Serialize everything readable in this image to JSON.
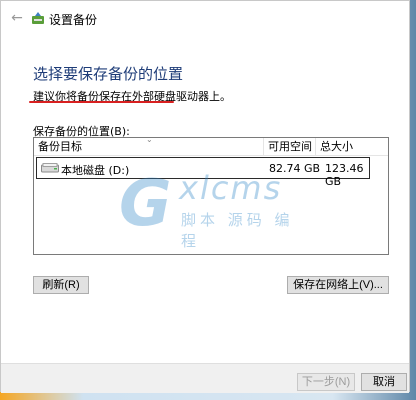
{
  "window": {
    "title": "设置备份"
  },
  "page": {
    "heading": "选择要保存备份的位置",
    "recommendation": "建议你将备份保存在外部硬盘驱动器上。"
  },
  "list": {
    "label": "保存备份的位置(B):",
    "columns": [
      "备份目标",
      "可用空间",
      "总大小"
    ],
    "rows": [
      {
        "name": "本地磁盘 (D:)",
        "free": "82.74 GB",
        "total": "123.46 GB"
      }
    ]
  },
  "buttons": {
    "refresh": "刷新(R)",
    "network": "保存在网络上(V)...",
    "next": "下一步(N)",
    "cancel": "取消"
  },
  "watermark": {
    "brand": "xlcms",
    "letter": "G",
    "subtitle": "脚本 源码 编程"
  },
  "colors": {
    "heading": "#1e3c78",
    "underline": "#d82020",
    "watermark": "#2f85c8"
  }
}
